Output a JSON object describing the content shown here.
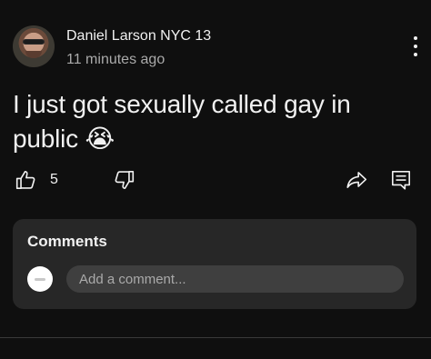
{
  "post": {
    "author": "Daniel Larson NYC 13",
    "timestamp": "11 minutes ago",
    "text": "I just got sexually called gay in public 😭"
  },
  "actions": {
    "like_count": "5",
    "like_icon": "thumbs-up-icon",
    "dislike_icon": "thumbs-down-icon",
    "share_icon": "share-icon",
    "comment_icon": "comment-icon",
    "more_icon": "more-vertical-icon"
  },
  "comments": {
    "title": "Comments",
    "placeholder": "Add a comment..."
  },
  "colors": {
    "background": "#0f0f0f",
    "card": "#272727",
    "input": "#3f3f3f",
    "text_primary": "#f1f1f1",
    "text_secondary": "#aaaaaa"
  }
}
